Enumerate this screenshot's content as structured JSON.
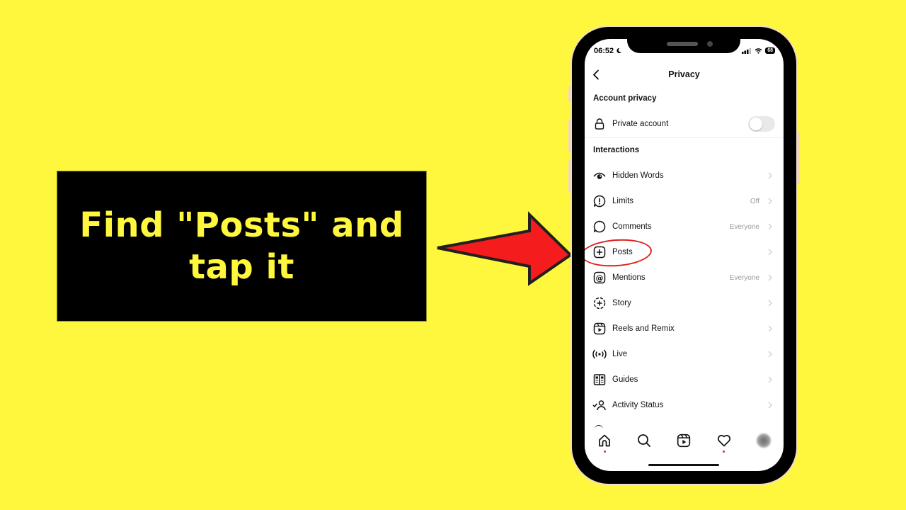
{
  "callout": {
    "text": "Find \"Posts\" and tap it",
    "text_color": "#fef73e",
    "background": "#000000"
  },
  "arrow": {
    "fill": "#f41c1c",
    "stroke": "#231f20",
    "direction": "right"
  },
  "page_background": "#fef73e",
  "phone": {
    "status_bar": {
      "time": "06:52",
      "moon_icon": "moon-icon",
      "signal_icon": "cellular-signal-icon",
      "wifi_icon": "wifi-icon",
      "battery": "68"
    },
    "header": {
      "back_icon": "chevron-left-icon",
      "title": "Privacy"
    },
    "account_section": {
      "title": "Account privacy",
      "private_account": {
        "label": "Private account",
        "icon": "lock-icon",
        "toggle_on": false
      }
    },
    "interactions_section": {
      "title": "Interactions",
      "items": [
        {
          "label": "Hidden Words",
          "icon": "eye-icon",
          "value": ""
        },
        {
          "label": "Limits",
          "icon": "limits-icon",
          "value": "Off"
        },
        {
          "label": "Comments",
          "icon": "comment-icon",
          "value": "Everyone"
        },
        {
          "label": "Posts",
          "icon": "plus-square-icon",
          "value": "",
          "highlighted": true
        },
        {
          "label": "Mentions",
          "icon": "at-icon",
          "value": "Everyone"
        },
        {
          "label": "Story",
          "icon": "story-plus-icon",
          "value": ""
        },
        {
          "label": "Reels and Remix",
          "icon": "reels-icon",
          "value": ""
        },
        {
          "label": "Live",
          "icon": "live-icon",
          "value": ""
        },
        {
          "label": "Guides",
          "icon": "guides-icon",
          "value": ""
        },
        {
          "label": "Activity Status",
          "icon": "activity-status-icon",
          "value": ""
        }
      ]
    },
    "highlight_color": "#e0201f",
    "tab_bar": [
      {
        "name": "home",
        "icon": "home-icon",
        "dot": true
      },
      {
        "name": "search",
        "icon": "search-icon",
        "dot": false
      },
      {
        "name": "reels",
        "icon": "reels-icon",
        "dot": false
      },
      {
        "name": "activity",
        "icon": "heart-icon",
        "dot": true
      },
      {
        "name": "profile",
        "icon": "avatar",
        "dot": false
      }
    ]
  }
}
